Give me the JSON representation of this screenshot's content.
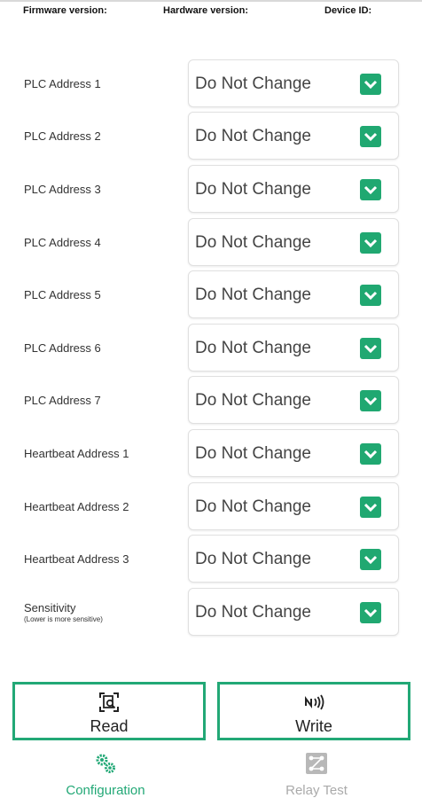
{
  "header": {
    "firmware_label": "Firmware version:",
    "hardware_label": "Hardware version:",
    "device_id_label": "Device ID:"
  },
  "fields": [
    {
      "label": "PLC Address 1",
      "value": "Do Not Change"
    },
    {
      "label": "PLC Address 2",
      "value": "Do Not Change"
    },
    {
      "label": "PLC Address 3",
      "value": "Do Not Change"
    },
    {
      "label": "PLC Address 4",
      "value": "Do Not Change"
    },
    {
      "label": "PLC Address 5",
      "value": "Do Not Change"
    },
    {
      "label": "PLC Address 6",
      "value": "Do Not Change"
    },
    {
      "label": "PLC Address 7",
      "value": "Do Not Change"
    },
    {
      "label": "Heartbeat Address 1",
      "value": "Do Not Change"
    },
    {
      "label": "Heartbeat Address 2",
      "value": "Do Not Change"
    },
    {
      "label": "Heartbeat Address 3",
      "value": "Do Not Change"
    },
    {
      "label": "Sensitivity",
      "sublabel": "(Lower is more sensitive)",
      "value": "Do Not Change"
    }
  ],
  "actions": {
    "read_label": "Read",
    "write_label": "Write"
  },
  "tabs": {
    "configuration_label": "Configuration",
    "relay_test_label": "Relay Test"
  },
  "icons": {
    "dropdown": "chevron-down-icon",
    "read": "scan-document-icon",
    "write": "nfc-icon",
    "configuration": "gears-icon",
    "relay_test": "relay-switch-icon"
  },
  "colors": {
    "accent": "#22a876",
    "dropdown_button": "#20a871",
    "inactive_tab": "#aaaaaa"
  }
}
